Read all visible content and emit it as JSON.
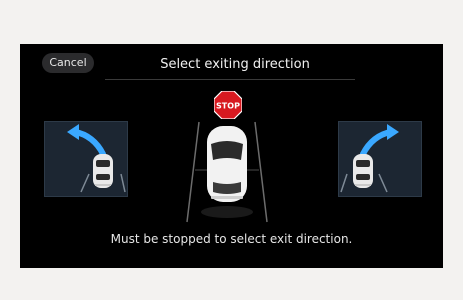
{
  "screen": {
    "cancel_label": "Cancel",
    "title": "Select exiting direction",
    "hint": "Must be stopped to select exit direction.",
    "stop_sign_text": "STOP"
  },
  "options": [
    {
      "direction": "left",
      "icon": "left-exit-arrow-icon"
    },
    {
      "direction": "right",
      "icon": "right-exit-arrow-icon"
    }
  ],
  "colors": {
    "accent_arrow": "#3aa8ff",
    "stop_red": "#d71920",
    "panel_bg": "#1c2632",
    "screen_bg": "#000000"
  }
}
